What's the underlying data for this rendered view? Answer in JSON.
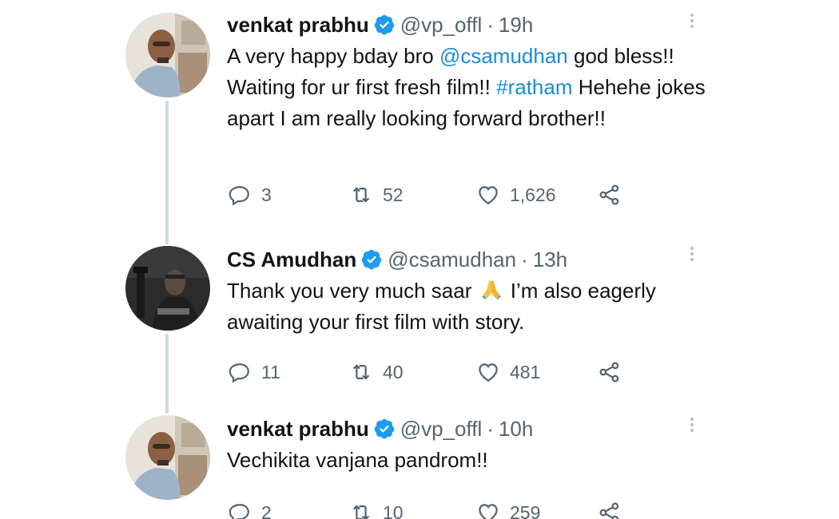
{
  "tweets": [
    {
      "name": "venkat prabhu",
      "handle": "@vp_offl",
      "time": "19h",
      "text": {
        "p1": "A very happy bday bro ",
        "mention": "@csamudhan",
        "p2": " god bless!! Waiting for ur first fresh film!! ",
        "hashtag": "#ratham",
        "p3": " Hehehe jokes apart I am really looking forward brother!!"
      },
      "replies": "3",
      "retweets": "52",
      "likes": "1,626"
    },
    {
      "name": "CS Amudhan",
      "handle": "@csamudhan",
      "time": "13h",
      "text": {
        "p1": "Thank you very much saar ",
        "emoji": "folded-hands-emoji",
        "p2": " I’m also eagerly awaiting your first film with story."
      },
      "replies": "11",
      "retweets": "40",
      "likes": "481"
    },
    {
      "name": "venkat prabhu",
      "handle": "@vp_offl",
      "time": "10h",
      "text": {
        "p1": "Vechikita vanjana pandrom!!"
      },
      "replies": "2",
      "retweets": "10",
      "likes": "259"
    }
  ],
  "separator": "·",
  "icons": {
    "reply": "reply-icon",
    "retweet": "retweet-icon",
    "like": "like-icon",
    "share": "share-icon",
    "more": "more-options-icon",
    "verified": "verified-badge-icon"
  },
  "colors": {
    "text": "#0f1419",
    "secondary": "#536471",
    "link": "#1d9bf0",
    "verified": "#1d9bf0",
    "thread_line": "#cfd9de"
  }
}
